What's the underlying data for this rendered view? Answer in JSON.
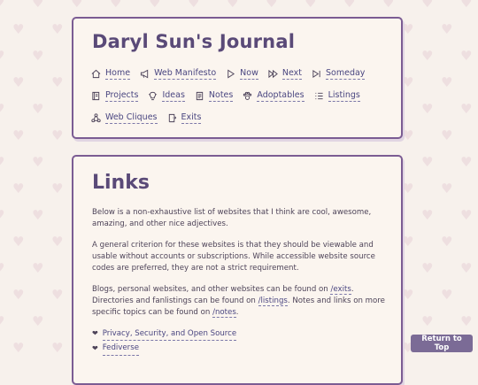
{
  "site": {
    "title": "Daryl Sun's Journal"
  },
  "nav": [
    [
      {
        "label": "Home",
        "icon": "home-icon"
      },
      {
        "label": "Web Manifesto",
        "icon": "megaphone-icon"
      },
      {
        "label": "Now",
        "icon": "play-icon"
      },
      {
        "label": "Next",
        "icon": "fast-forward-icon"
      },
      {
        "label": "Someday",
        "icon": "skip-forward-icon"
      }
    ],
    [
      {
        "label": "Projects",
        "icon": "notebook-icon"
      },
      {
        "label": "Ideas",
        "icon": "lightbulb-icon"
      },
      {
        "label": "Notes",
        "icon": "notes-icon"
      },
      {
        "label": "Adoptables",
        "icon": "paw-icon"
      },
      {
        "label": "Listings",
        "icon": "list-icon"
      }
    ],
    [
      {
        "label": "Web Cliques",
        "icon": "network-icon"
      },
      {
        "label": "Exits",
        "icon": "door-icon"
      }
    ]
  ],
  "page": {
    "heading": "Links",
    "p1": "Below is a non-exhaustive list of websites that I think are cool, awesome, amazing, and other nice adjectives.",
    "p2": "A general criterion for these websites is that they should be viewable and usable without accounts or subscriptions. While accessible website source codes are preferred, they are not a strict requirement.",
    "p3": {
      "a": "Blogs, personal websites, and other websites can be found on ",
      "link_exits": "/exits",
      "b": ". Directories and fanlistings can be found on ",
      "link_listings": "/listings",
      "c": ". Notes and links on more specific topics can be found on ",
      "link_notes": "/notes",
      "d": "."
    },
    "list": [
      {
        "label": "Privacy, Security, and Open Source"
      },
      {
        "label": "Fediverse"
      }
    ]
  },
  "return_top": {
    "label": "Return to Top"
  },
  "colors": {
    "accent": "#7b5c93",
    "link": "#4a4680",
    "background": "#f7f1ec",
    "button": "#7b6b96"
  }
}
